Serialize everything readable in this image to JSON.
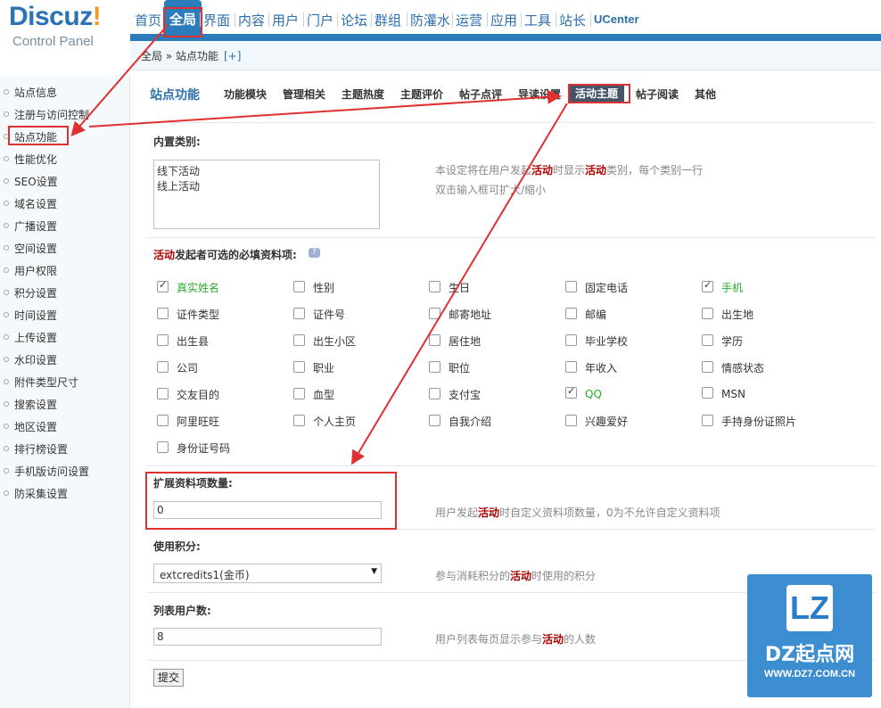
{
  "logo": {
    "brand": "Discuz",
    "brand_mark": "!",
    "subtitle": "Control Panel"
  },
  "topnav": {
    "items": [
      "首页",
      "全局",
      "界面",
      "内容",
      "用户",
      "门户",
      "论坛",
      "群组",
      "防灌水",
      "运营",
      "应用",
      "工具",
      "站长",
      "UCenter"
    ],
    "active": "全局"
  },
  "breadcrumb": {
    "path": "全局 » 站点功能",
    "add": "[+]"
  },
  "sidebar": {
    "items": [
      "站点信息",
      "注册与访问控制",
      "站点功能",
      "性能优化",
      "SEO设置",
      "域名设置",
      "广播设置",
      "空间设置",
      "用户权限",
      "积分设置",
      "时间设置",
      "上传设置",
      "水印设置",
      "附件类型尺寸",
      "搜索设置",
      "地区设置",
      "排行榜设置",
      "手机版访问设置",
      "防采集设置"
    ],
    "active": "站点功能"
  },
  "page": {
    "title": "站点功能",
    "tabs": [
      "功能模块",
      "管理相关",
      "主题热度",
      "主题评价",
      "帖子点评",
      "导读设置",
      "活动主题",
      "帖子阅读",
      "其他"
    ],
    "active_tab": "活动主题"
  },
  "builtin_types": {
    "label": "内置类别:",
    "value": "线下活动\n线上活动",
    "hint_pre": "本设定将在用户发起",
    "hint_kw1": "活动",
    "hint_mid": "时显示",
    "hint_kw2": "活动",
    "hint_post": "类别，每个类别一行",
    "hint_line2": "双击输入框可扩大/缩小"
  },
  "required_fields": {
    "label_kw": "活动",
    "label_rest": "发起者可选的必填资料项:",
    "help_icon": "?",
    "options": [
      {
        "label": "真实姓名",
        "checked": true
      },
      {
        "label": "性别",
        "checked": false
      },
      {
        "label": "生日",
        "checked": false
      },
      {
        "label": "固定电话",
        "checked": false
      },
      {
        "label": "手机",
        "checked": true
      },
      {
        "label": "证件类型",
        "checked": false
      },
      {
        "label": "证件号",
        "checked": false
      },
      {
        "label": "邮寄地址",
        "checked": false
      },
      {
        "label": "邮编",
        "checked": false
      },
      {
        "label": "出生地",
        "checked": false
      },
      {
        "label": "出生县",
        "checked": false
      },
      {
        "label": "出生小区",
        "checked": false
      },
      {
        "label": "居住地",
        "checked": false
      },
      {
        "label": "毕业学校",
        "checked": false
      },
      {
        "label": "学历",
        "checked": false
      },
      {
        "label": "公司",
        "checked": false
      },
      {
        "label": "职业",
        "checked": false
      },
      {
        "label": "职位",
        "checked": false
      },
      {
        "label": "年收入",
        "checked": false
      },
      {
        "label": "情感状态",
        "checked": false
      },
      {
        "label": "交友目的",
        "checked": false
      },
      {
        "label": "血型",
        "checked": false
      },
      {
        "label": "支付宝",
        "checked": false
      },
      {
        "label": "QQ",
        "checked": true
      },
      {
        "label": "MSN",
        "checked": false
      },
      {
        "label": "阿里旺旺",
        "checked": false
      },
      {
        "label": "个人主页",
        "checked": false
      },
      {
        "label": "自我介绍",
        "checked": false
      },
      {
        "label": "兴趣爱好",
        "checked": false
      },
      {
        "label": "手持身份证照片",
        "checked": false
      },
      {
        "label": "身份证号码",
        "checked": false
      }
    ]
  },
  "extend_count": {
    "label": "扩展资料项数量:",
    "value": "0",
    "hint_pre": "用户发起",
    "hint_kw": "活动",
    "hint_post": "时自定义资料项数量，0为不允许自定义资料项"
  },
  "credits": {
    "label": "使用积分:",
    "value": "extcredits1(金币)",
    "hint_pre": "参与消耗积分的",
    "hint_kw": "活动",
    "hint_post": "时使用的积分"
  },
  "list_users": {
    "label": "列表用户数:",
    "value": "8",
    "hint_pre": "用户列表每页显示参与",
    "hint_kw": "活动",
    "hint_post": "的人数"
  },
  "submit_label": "提交",
  "watermark": {
    "logo": "LZ",
    "name": "DZ起点网",
    "url": "WWW.DZ7.COM.CN"
  },
  "colors": {
    "accent": "#2c7bba",
    "annotation": "#e03131",
    "keyword": "#b00000",
    "checked_label": "#2cab2c"
  }
}
